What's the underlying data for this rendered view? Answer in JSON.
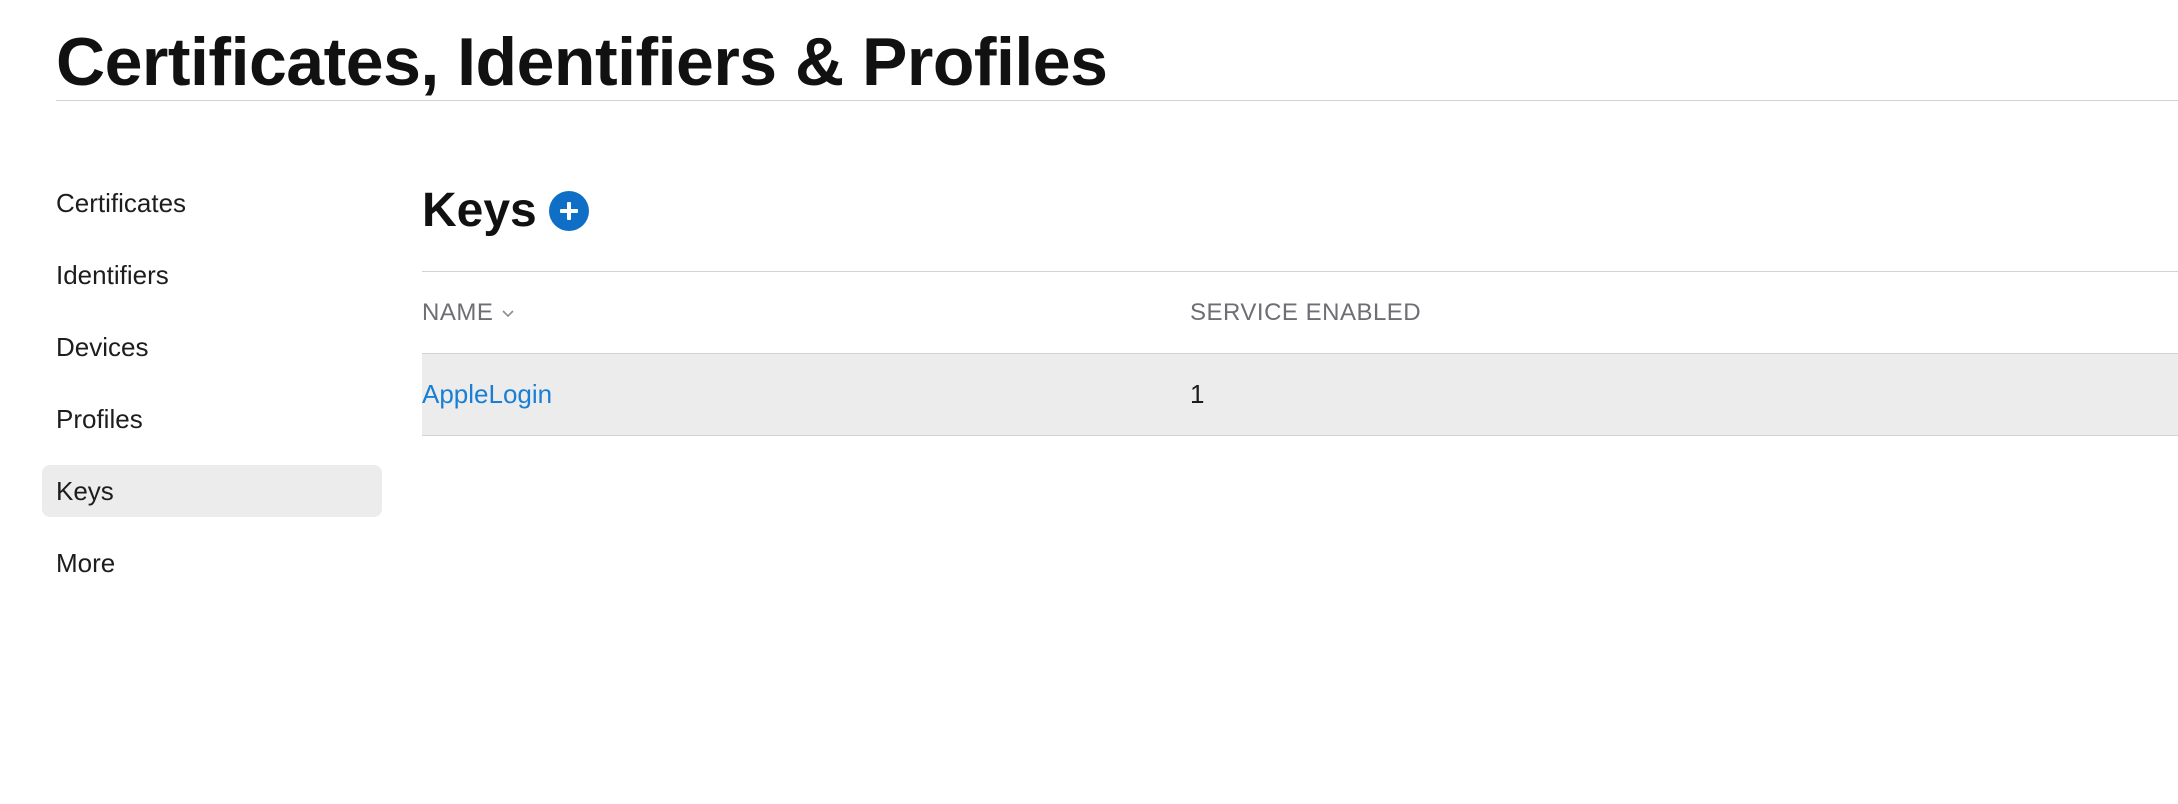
{
  "header": {
    "title": "Certificates, Identifiers & Profiles"
  },
  "sidebar": {
    "items": [
      {
        "label": "Certificates",
        "active": false
      },
      {
        "label": "Identifiers",
        "active": false
      },
      {
        "label": "Devices",
        "active": false
      },
      {
        "label": "Profiles",
        "active": false
      },
      {
        "label": "Keys",
        "active": true
      },
      {
        "label": "More",
        "active": false
      }
    ]
  },
  "main": {
    "title": "Keys",
    "add_icon": "plus-circle-icon",
    "table": {
      "columns": [
        {
          "label": "NAME",
          "sortable": true,
          "sort_icon": "chevron-down-icon"
        },
        {
          "label": "SERVICE ENABLED",
          "sortable": false
        }
      ],
      "rows": [
        {
          "name": "AppleLogin",
          "service_enabled": "1"
        }
      ]
    }
  },
  "colors": {
    "accent": "#0f6fc6",
    "link": "#1a7fd4",
    "selected_bg": "#ececec",
    "divider": "#d2d2d7"
  }
}
